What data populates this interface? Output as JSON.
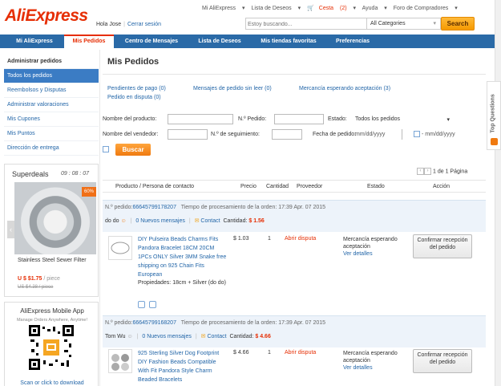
{
  "header": {
    "logo": "AliExpress",
    "greeting": "Hola Jose",
    "logout": "Cerrar sesión",
    "topnav": [
      {
        "label": "Mi AliExpress",
        "dropdown": true
      },
      {
        "label": "Lista de Deseos",
        "dropdown": true
      },
      {
        "label": "Cesta",
        "count": "(2)",
        "dropdown": true
      },
      {
        "label": "Ayuda",
        "dropdown": true
      },
      {
        "label": "Foro de Compradores",
        "dropdown": true
      }
    ],
    "search": {
      "placeholder": "Estoy buscando...",
      "category": "All Categories",
      "button": "Search"
    }
  },
  "navbar": {
    "tabs": [
      {
        "label": "Mi AliExpress",
        "active": false
      },
      {
        "label": "Mis Pedidos",
        "active": true
      },
      {
        "label": "Centro de Mensajes",
        "active": false
      },
      {
        "label": "Lista de Deseos",
        "active": false
      },
      {
        "label": "Mis tiendas favoritas",
        "active": false
      },
      {
        "label": "Preferencias",
        "active": false
      }
    ]
  },
  "sidebar": {
    "heading": "Administrar pedidos",
    "items": [
      {
        "label": "Todos los pedidos",
        "active": true
      },
      {
        "label": "Reembolsos y Disputas",
        "active": false
      },
      {
        "label": "Administrar valoraciones",
        "active": false
      },
      {
        "label": "Mis Cupones",
        "active": false
      },
      {
        "label": "Mis Puntos",
        "active": false
      },
      {
        "label": "Dirección de entrega",
        "active": false
      }
    ]
  },
  "superdeals": {
    "title": "Superdeals",
    "timer": "09 : 08 : 07",
    "badge": "60%",
    "product_name": "Stainless Steel Sewer Filter",
    "price": "U $ $1.75",
    "price_unit": "/ piece",
    "old_price": "US $4.38 / piece"
  },
  "mobile_app": {
    "title": "AliExpress Mobile App",
    "subtitle": "Manage Orders Anywhere, Anytime!",
    "link": "Scan or click to download"
  },
  "main": {
    "title": "Mis Pedidos",
    "status_links": [
      {
        "label": "Pendientes de pago",
        "count": "(0)"
      },
      {
        "label": "Mensajes de pedido sin leer",
        "count": "(0)"
      },
      {
        "label": "Mercancía esperando aceptación",
        "count": "(3)"
      },
      {
        "label": "Pedido en disputa",
        "count": "(0)"
      }
    ],
    "filters": {
      "product_label": "Nombre del producto:",
      "order_no_label": "N.º Pedido:",
      "status_label": "Estado:",
      "status_value": "Todos los pedidos",
      "seller_label": "Nombre del vendedor:",
      "tracking_label": "N.º de seguimiento:",
      "date_label": "Fecha de pedido:",
      "date_from_placeholder": "mm/dd/yyyy",
      "date_to_placeholder": "mm/dd/yyyy",
      "search_button": "Buscar"
    },
    "pager": {
      "current": "1",
      "of": "de",
      "total": "1",
      "label": "Página"
    },
    "table_headers": [
      "Producto / Persona de contacto",
      "Precio",
      "Cantidad",
      "Proveedor",
      "Estado",
      "Acción"
    ],
    "orders": [
      {
        "order_label": "N.º pedido:",
        "order_no": "66645799178207",
        "processing_label": "Tiempo de procesamiento de la orden:",
        "processing_time": "17:39 Apr. 07 2015",
        "seller": "do do",
        "messages": "0 Nuevos mensajes",
        "contact": "Contact",
        "amount_label": "Cantidad:",
        "amount": "$ 1.56",
        "product": "DIY Pulseira Beads Charms Fits Pandora Bracelet 18CM 20CM 1PCs ONLY Silver 3MM Snake free shipping on 925 Chain Fits European",
        "properties": "Propiedades: 18cm + Silver (do do)",
        "price": "$ 1.03",
        "qty": "1",
        "dispute": "Abrir disputa",
        "status": "Mercancía esperando aceptación",
        "details": "Ver detalles",
        "action": "Confirmar recepción del pedido"
      },
      {
        "order_label": "N.º pedido:",
        "order_no": "66645799168207",
        "processing_label": "Tiempo de procesamiento de la orden:",
        "processing_time": "17:39 Apr. 07 2015",
        "seller": "Tom Wu",
        "messages": "0 Nuevos mensajes",
        "contact": "Contact",
        "amount_label": "Cantidad:",
        "amount": "$ 4.66",
        "product": "925 Sterling Silver Dog Footprint DIY Fashion Beads Compatible With Fit Pandora Style Charm Beaded Bracelets",
        "price": "$ 4.66",
        "qty": "1",
        "dispute": "Abrir disputa",
        "status": "Mercancía esperando aceptación",
        "details": "Ver detalles",
        "action": "Confirmar recepción del pedido"
      }
    ]
  },
  "feedback_tab": "Top Questions",
  "colors": {
    "brand": "#e62e04",
    "nav": "#2a6aa7",
    "link": "#2366a8",
    "button": "#f07a10"
  }
}
